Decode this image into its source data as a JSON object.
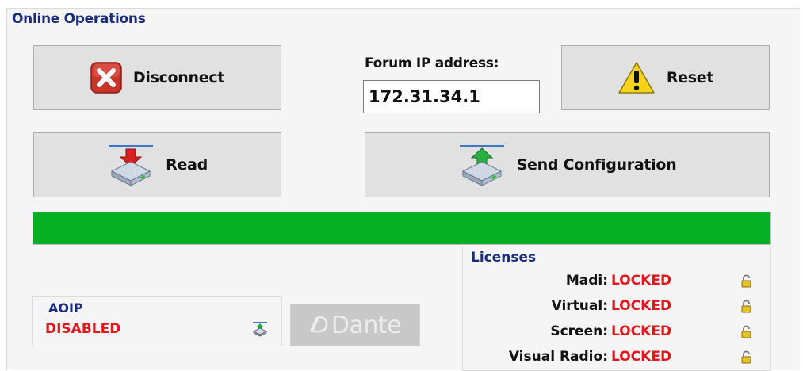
{
  "section": {
    "title": "Online Operations"
  },
  "buttons": {
    "disconnect": "Disconnect",
    "reset": "Reset",
    "read": "Read",
    "send_configuration": "Send Configuration"
  },
  "ip": {
    "label": "Forum IP address:",
    "value": "172.31.34.1"
  },
  "progress": {
    "fraction": 1.0,
    "color": "#06b025"
  },
  "aoip": {
    "title": "AOIP",
    "status": "DISABLED",
    "icon": "upload-drive-icon"
  },
  "dante": {
    "label": "Dante",
    "enabled": false
  },
  "licenses": {
    "title": "Licenses",
    "items": [
      {
        "name": "Madi:",
        "status": "LOCKED",
        "icon": "lock-icon"
      },
      {
        "name": "Virtual:",
        "status": "LOCKED",
        "icon": "lock-icon"
      },
      {
        "name": "Screen:",
        "status": "LOCKED",
        "icon": "lock-icon"
      },
      {
        "name": "Visual Radio:",
        "status": "LOCKED",
        "icon": "lock-icon"
      }
    ]
  },
  "colors": {
    "title_blue": "#1a2c7c",
    "status_red": "#e8141c",
    "progress_green": "#06b025"
  }
}
